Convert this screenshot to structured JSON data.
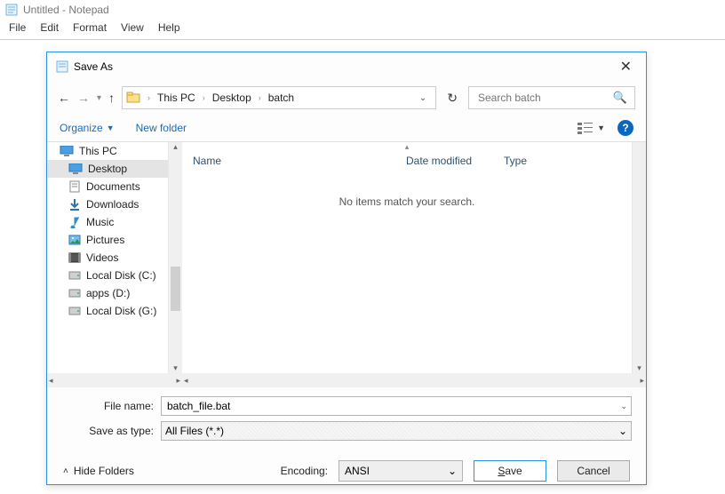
{
  "notepad": {
    "title": "Untitled - Notepad",
    "menu": [
      "File",
      "Edit",
      "Format",
      "View",
      "Help"
    ]
  },
  "dialog": {
    "title": "Save As",
    "breadcrumbs": [
      "This PC",
      "Desktop",
      "batch"
    ],
    "search_placeholder": "Search batch",
    "toolbar": {
      "organize": "Organize",
      "newfolder": "New folder"
    },
    "navtree": [
      "This PC",
      "Desktop",
      "Documents",
      "Downloads",
      "Music",
      "Pictures",
      "Videos",
      "Local Disk (C:)",
      "apps (D:)",
      "Local Disk (G:)"
    ],
    "selected_nav": "Desktop",
    "columns": {
      "name": "Name",
      "date": "Date modified",
      "type": "Type"
    },
    "empty_text": "No items match your search.",
    "filename_label": "File name:",
    "filename_value": "batch_file.bat",
    "savetype_label": "Save as type:",
    "savetype_value": "All Files  (*.*)",
    "hidefolders": "Hide Folders",
    "encoding_label": "Encoding:",
    "encoding_value": "ANSI",
    "save_btn": "Save",
    "cancel_btn": "Cancel"
  }
}
